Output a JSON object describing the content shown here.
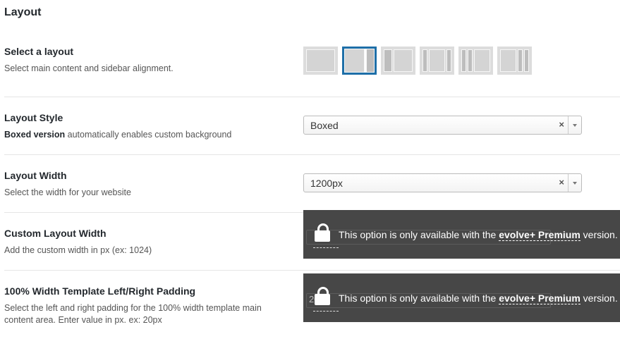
{
  "section": {
    "title": "Layout"
  },
  "select_layout": {
    "label": "Select a layout",
    "description": "Select main content and sidebar alignment.",
    "options": [
      {
        "name": "full-width",
        "selected": false
      },
      {
        "name": "right-sidebar",
        "selected": true
      },
      {
        "name": "left-sidebar",
        "selected": false
      },
      {
        "name": "two-sidebars-left",
        "selected": false
      },
      {
        "name": "two-sidebars-left-b",
        "selected": false
      },
      {
        "name": "two-sidebars-right",
        "selected": false
      }
    ]
  },
  "layout_style": {
    "label": "Layout Style",
    "description_bold": "Boxed version",
    "description_rest": " automatically enables custom background",
    "value": "Boxed",
    "clear": "×"
  },
  "layout_width": {
    "label": "Layout Width",
    "description": "Select the width for your website",
    "value": "1200px",
    "clear": "×"
  },
  "custom_layout_width": {
    "label": "Custom Layout Width",
    "description": "Add the custom width in px (ex: 1024)"
  },
  "template_padding": {
    "label": "100% Width Template Left/Right Padding",
    "description": "Select the left and right padding for the 100% width template main content area. Enter value in px. ex: 20px",
    "field_value": "20px"
  },
  "premium_notice": {
    "before": "This option is only available with the ",
    "brand": "evolve+ Premium",
    "after": " version."
  },
  "colors": {
    "accent": "#1e6fa8",
    "overlay": "#474747"
  }
}
